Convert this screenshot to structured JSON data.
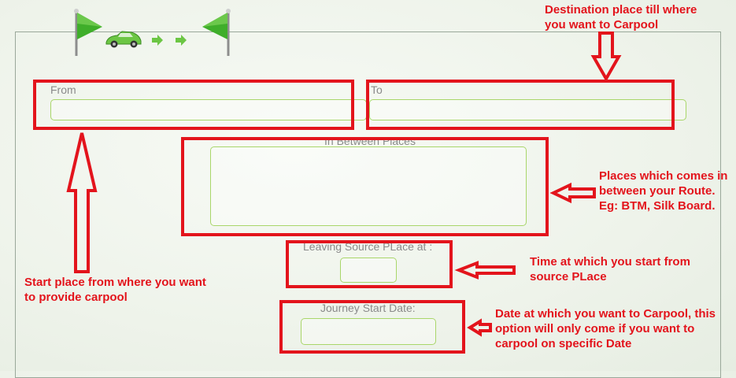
{
  "route_header": {
    "start_flag_icon": "flag-icon",
    "car_icon": "car-icon",
    "arrow_icons": [
      "arrow-right-icon",
      "arrow-right-icon"
    ],
    "end_flag_icon": "flag-icon"
  },
  "form": {
    "from_label": "From",
    "from_value": "",
    "to_label": "To",
    "to_value": "",
    "in_between_label": "In Between Places",
    "in_between_value": "",
    "leaving_time_label": "Leaving Source PLace at :",
    "leaving_time_value": "",
    "journey_date_label": "Journey Start Date:",
    "journey_date_value": ""
  },
  "annotations": {
    "destination": "Destination place till where you want to Carpool",
    "start_place": "Start place from where you want to provide carpool",
    "places_between": "Places which comes in between your Route. Eg: BTM, Silk Board.",
    "time": "Time at which you start from source PLace",
    "date": "Date at which you want to Carpool, this option will only come if you want to carpool on specific Date"
  },
  "colors": {
    "annotation_red": "#e3141c",
    "field_border_green": "#a9d66a",
    "flag_green": "#3fae2a",
    "car_green": "#6cc644"
  }
}
